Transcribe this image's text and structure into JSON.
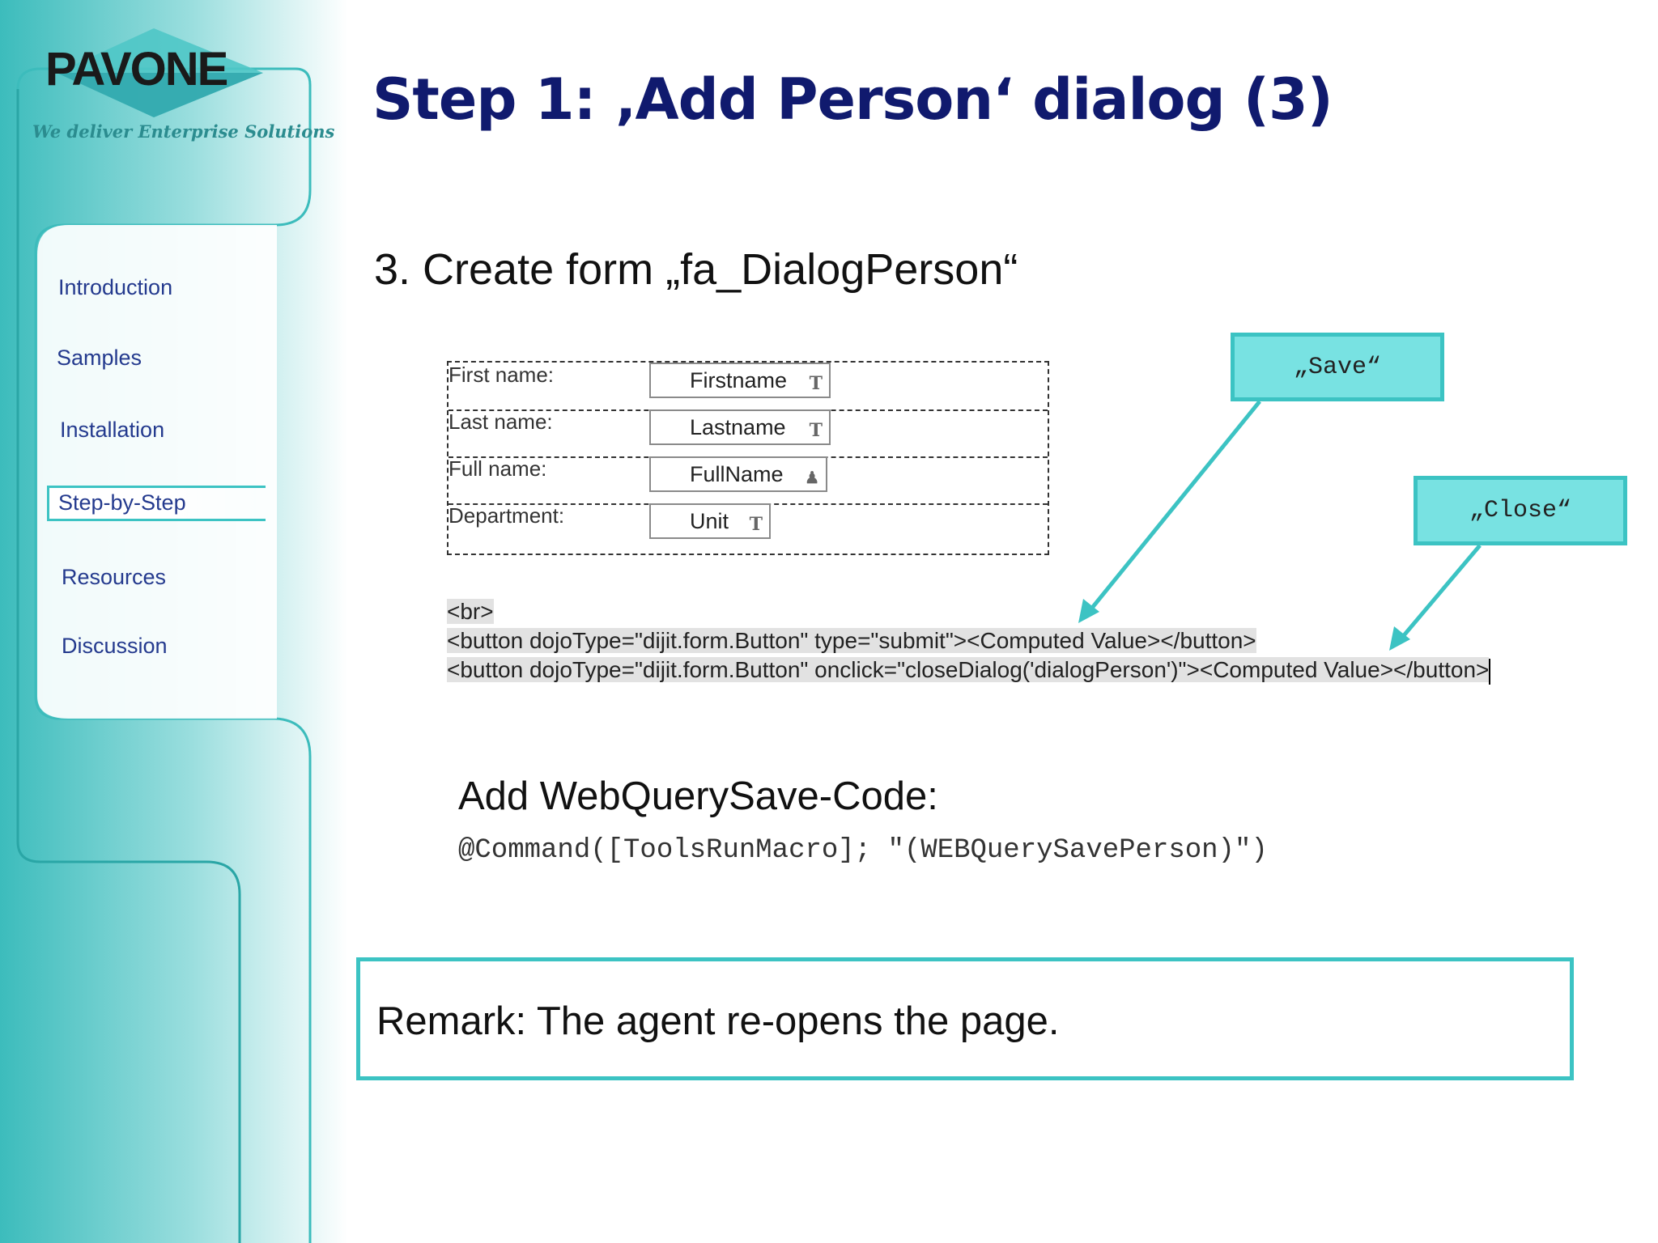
{
  "brand": {
    "name": "PAVONE",
    "tagline": "We deliver Enterprise Solutions"
  },
  "sidebar": {
    "items": [
      {
        "label": "Introduction",
        "active": false
      },
      {
        "label": "Samples",
        "active": false
      },
      {
        "label": "Installation",
        "active": false
      },
      {
        "label": "Step-by-Step",
        "active": true
      },
      {
        "label": "Resources",
        "active": false
      },
      {
        "label": "Discussion",
        "active": false
      }
    ]
  },
  "slide": {
    "title": "Step 1: ‚Add Person‘ dialog (3)",
    "subtitle": "3. Create form „fa_DialogPerson“"
  },
  "form": {
    "rows": [
      {
        "label": "First name:",
        "field": "Firstname",
        "icon": "text-field-icon"
      },
      {
        "label": "Last name:",
        "field": "Lastname",
        "icon": "text-field-icon"
      },
      {
        "label": "Full name:",
        "field": "FullName",
        "icon": "names-field-icon"
      },
      {
        "label": "Department:",
        "field": "Unit",
        "icon": "text-field-icon"
      }
    ]
  },
  "code": {
    "lines": [
      "<br>",
      "<button dojoType=\"dijit.form.Button\" type=\"submit\"><Computed Value></button>",
      "<button dojoType=\"dijit.form.Button\" onclick=\"closeDialog('dialogPerson')\"><Computed Value></button>"
    ]
  },
  "callouts": {
    "save": "„Save“",
    "close": "„Close“"
  },
  "webquery": {
    "title": "Add WebQuerySave-Code:",
    "code": "@Command([ToolsRunMacro]; \"(WEBQuerySavePerson)\")"
  },
  "remark": {
    "text": "Remark: The agent re-opens the page."
  },
  "colors": {
    "accent": "#3cc3c3",
    "callout_fill": "#78e2e2",
    "title": "#101a6e",
    "nav": "#243a8e"
  }
}
